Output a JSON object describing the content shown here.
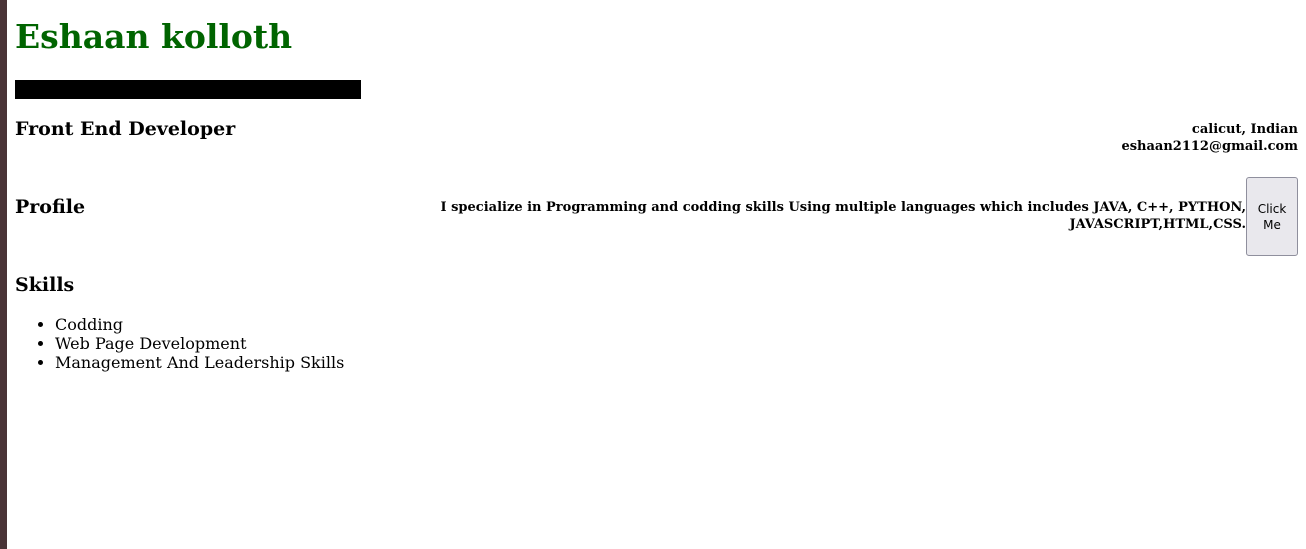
{
  "header": {
    "name": "Eshaan kolloth",
    "name_color": "#006400",
    "role": "Front End Developer"
  },
  "contact": {
    "location": "calicut, Indian",
    "email": "eshaan2112@gmail.com"
  },
  "profile": {
    "heading": "Profile",
    "text": "I specialize in Programming and codding skills Using multiple languages which includes JAVA, C++, PYTHON, JAVASCRIPT,HTML,CSS.",
    "button_label": "Click Me"
  },
  "skills": {
    "heading": "Skills",
    "items": [
      "Codding",
      "Web Page Development",
      "Management And Leadership Skills"
    ]
  }
}
